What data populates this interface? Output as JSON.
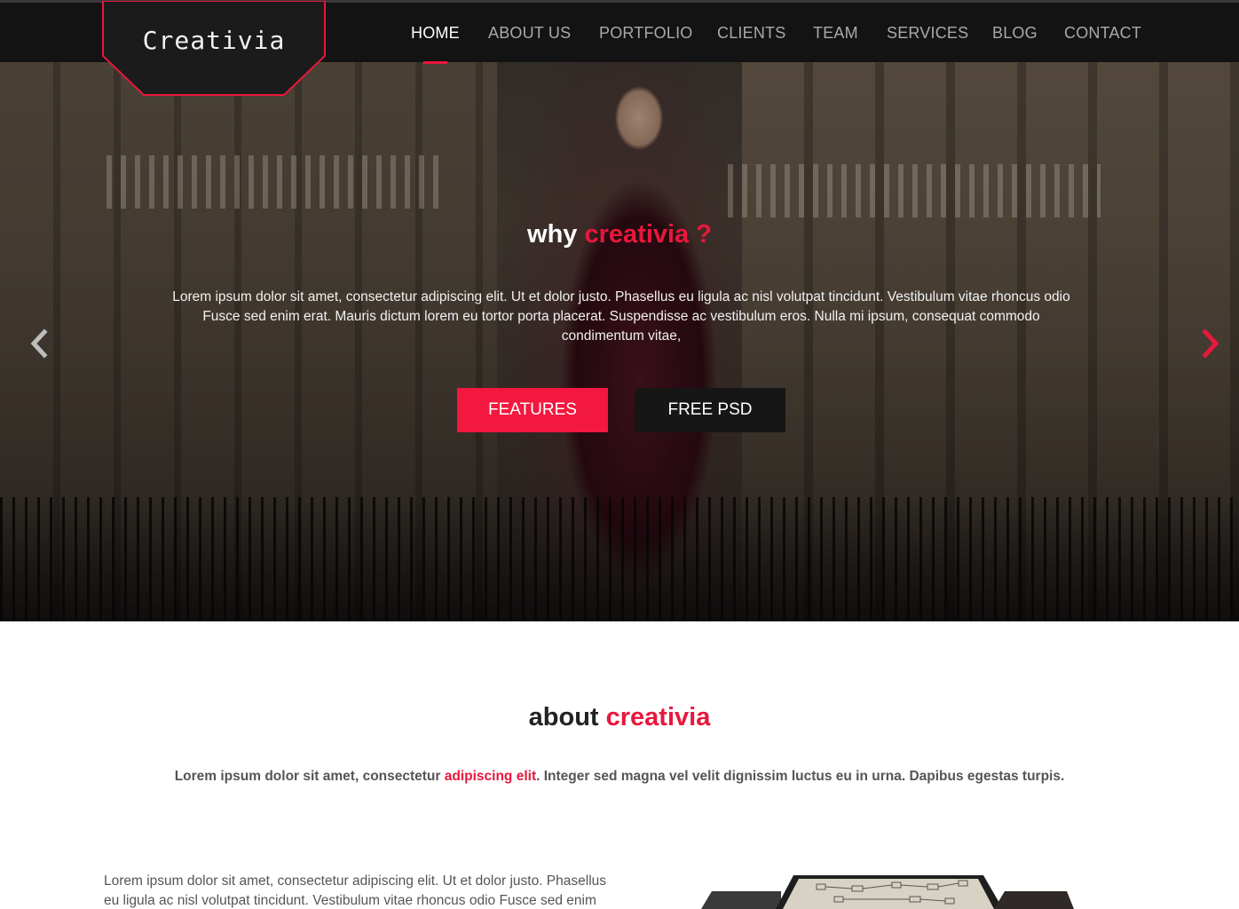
{
  "brand": {
    "name": "Creativia",
    "accent_color": "#e8173c"
  },
  "nav": {
    "items": [
      {
        "label": "HOME",
        "active": true
      },
      {
        "label": "ABOUT US",
        "active": false
      },
      {
        "label": "PORTFOLIO",
        "active": false
      },
      {
        "label": "CLIENTS",
        "active": false
      },
      {
        "label": "TEAM",
        "active": false
      },
      {
        "label": "SERVICES",
        "active": false
      },
      {
        "label": "BLOG",
        "active": false
      },
      {
        "label": "CONTACT",
        "active": false
      }
    ]
  },
  "hero": {
    "title_prefix": "why",
    "title_accent": "creativia ?",
    "text": "Lorem ipsum dolor sit amet, consectetur adipiscing elit. Ut et dolor justo. Phasellus eu ligula ac nisl volutpat tincidunt. Vestibulum vitae rhoncus odio Fusce sed enim erat. Mauris dictum lorem eu tortor porta placerat. Suspendisse ac vestibulum eros. Nulla mi ipsum, consequat commodo condimentum vitae,",
    "buttons": {
      "primary": "FEATURES",
      "secondary": "FREE PSD"
    },
    "prev_icon": "chevron-left-icon",
    "next_icon": "chevron-right-icon"
  },
  "about": {
    "title_prefix": "about",
    "title_accent": "creativia",
    "lead_before": "Lorem ipsum dolor sit amet, consectetur ",
    "lead_accent": "adipiscing elit",
    "lead_after": ". Integer sed magna vel velit dignissim luctus eu in urna. Dapibus egestas turpis.",
    "body": "Lorem ipsum dolor sit amet, consectetur adipiscing elit. Ut et dolor justo. Phasellus eu ligula ac nisl volutpat tincidunt. Vestibulum vitae rhoncus odio Fusce sed enim"
  }
}
